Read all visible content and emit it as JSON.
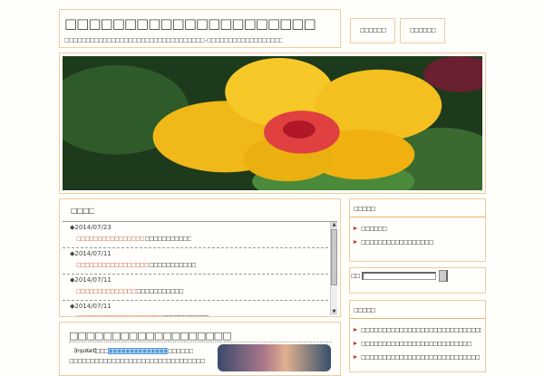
{
  "header": {
    "title": "□□□□□□□□□□□□□□□□□□□□□",
    "description": "□□□□□□□□□□□□□□□□□□□□□□□□□□□□□□□□□ - □□□□□□□□□□□□□□□□□□"
  },
  "nav": [
    {
      "label": "□□□□□□"
    },
    {
      "label": "□□□□□□"
    }
  ],
  "news": {
    "title": "□□□□",
    "items": [
      {
        "date": "◆2014/07/23",
        "link": "□□□□□□□□□□□□□□□□",
        "text": "□□□□□□□□□□□"
      },
      {
        "date": "◆2014/07/11",
        "link": "□□□□□□□□□□□□□□□□□",
        "text": "□□□□□□□□□□□"
      },
      {
        "date": "◆2014/07/11",
        "link": "□□□□□□□□□□□□□□",
        "text": "□□□□□□□□□□□"
      },
      {
        "date": "◆2014/07/11",
        "link": "□□□□□□□□□□□□□□□□□□□□",
        "text": "□□□□□□□□□□□"
      }
    ]
  },
  "article": {
    "title": "□□□□□□□□□□□□□□□□□□□",
    "line1_pre": "[important]□□□",
    "line1_highlight": "□□□□□□□□□□□□□□",
    "line1_post": "□□□□□□",
    "line2": "□□□□□□□□□□□□□□□□□□□□□□□□□□□□□□□□□□□□□□□□□□□"
  },
  "sidebar1": {
    "title": "□□□□□",
    "items": [
      "□□□□□□",
      "□□□□□□□□□□□□□□□□□"
    ]
  },
  "search": {
    "label": "□□:",
    "value": ""
  },
  "sidebar2": {
    "title": "□□□□□",
    "items": [
      "□□□□□□□□□□□□□□□□□□□□□□□□□□□□□□□□□□□□□□□□□□",
      "□□□□□□□□□□□□□□□□□□□□□□□□□□",
      "□□□□□□□□□□□□□□□□□□□□□□□□□□□□"
    ]
  }
}
